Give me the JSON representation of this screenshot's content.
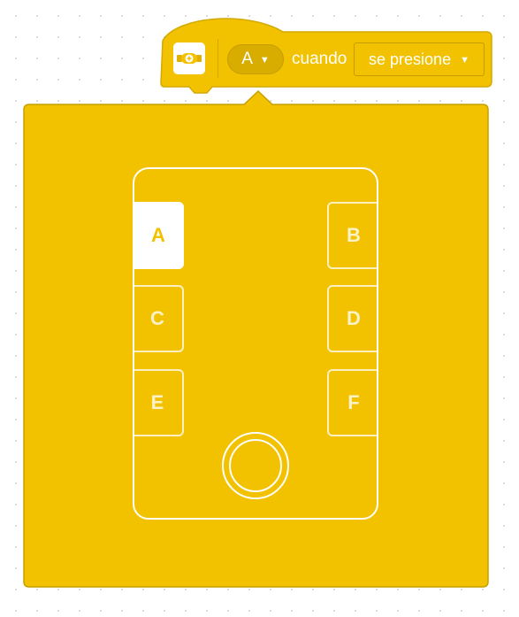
{
  "block": {
    "icon": "hub-icon",
    "port_value": "A",
    "word": "cuando",
    "condition_value": "se presione"
  },
  "popup": {
    "ports": [
      {
        "id": "A",
        "label": "A",
        "selected": true
      },
      {
        "id": "B",
        "label": "B",
        "selected": false
      },
      {
        "id": "C",
        "label": "C",
        "selected": false
      },
      {
        "id": "D",
        "label": "D",
        "selected": false
      },
      {
        "id": "E",
        "label": "E",
        "selected": false
      },
      {
        "id": "F",
        "label": "F",
        "selected": false
      }
    ],
    "center_button_icon": "center-button-icon"
  },
  "colors": {
    "block_fill": "#f2c200",
    "block_stroke": "#d4a900",
    "dropdown_fill": "#d9ad00",
    "popup_fill": "#f2c200",
    "popup_stroke": "#c7a000",
    "outline": "#ffffff",
    "canvas_dots": "#d9d9d9"
  }
}
